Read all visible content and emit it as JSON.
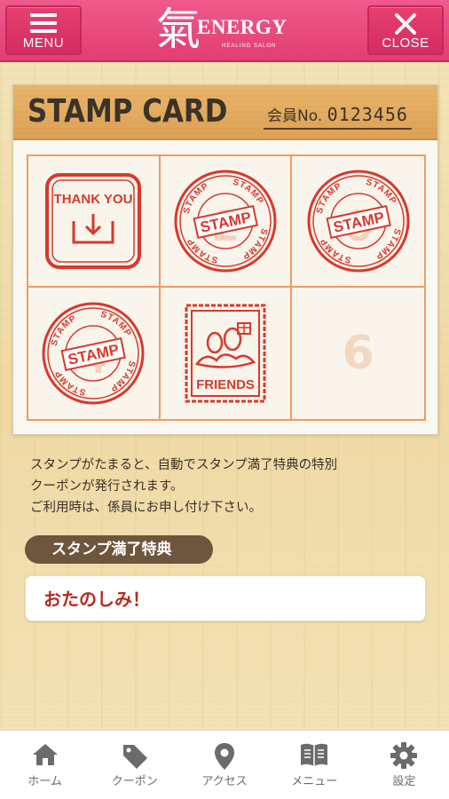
{
  "header": {
    "menu_label": "MENU",
    "close_label": "CLOSE",
    "logo": {
      "kanji": "氣",
      "brand": "ENERGY",
      "subtitle": "HEALING SALON"
    }
  },
  "card": {
    "title": "STAMP CARD",
    "member_label": "会員No.",
    "member_number": "0123456",
    "slots": [
      {
        "type": "thank-you",
        "text": "THANK YOU"
      },
      {
        "type": "stamp",
        "ring_text": "STAMP",
        "center_text": "STAMP",
        "number": "2"
      },
      {
        "type": "stamp",
        "ring_text": "STAMP",
        "center_text": "STAMP",
        "number": "3"
      },
      {
        "type": "stamp",
        "ring_text": "STAMP",
        "center_text": "STAMP",
        "number": "4"
      },
      {
        "type": "friends",
        "text": "FRIENDS"
      },
      {
        "type": "empty",
        "number": "6"
      }
    ]
  },
  "note": {
    "line1": "スタンプがたまると、自動でスタンプ満了特典の特別",
    "line2": "クーポンが発行されます。",
    "line3": "ご利用時は、係員にお申し付け下さい。"
  },
  "reward": {
    "heading": "スタンプ満了特典",
    "value": "おたのしみ！"
  },
  "tabs": [
    {
      "label": "ホーム",
      "icon": "home-icon"
    },
    {
      "label": "クーポン",
      "icon": "tag-icon"
    },
    {
      "label": "アクセス",
      "icon": "map-pin-icon"
    },
    {
      "label": "メニュー",
      "icon": "book-icon"
    },
    {
      "label": "設定",
      "icon": "gear-icon"
    }
  ],
  "colors": {
    "header_pink": "#e23d72",
    "stamp_red": "#d8392b",
    "grid_orange": "#ee9c5e",
    "pill_brown": "#6e553d",
    "reward_red": "#b9291f"
  }
}
